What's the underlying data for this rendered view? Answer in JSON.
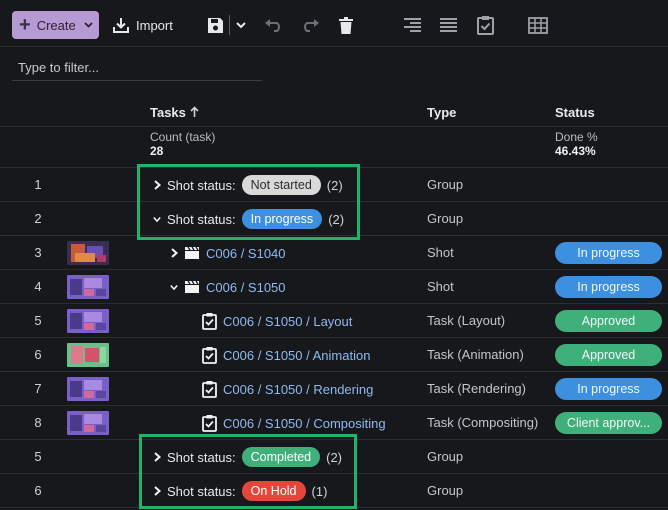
{
  "toolbar": {
    "create_label": "Create",
    "import_label": "Import",
    "icons": [
      "plus-icon",
      "chevron-down-icon",
      "import-icon",
      "save-icon",
      "undo-icon",
      "redo-icon",
      "trash-icon",
      "align-right-icon",
      "align-justify-icon",
      "clipboard-check-icon",
      "table-icon"
    ]
  },
  "filter": {
    "placeholder": "Type to filter..."
  },
  "columns": {
    "tasks": "Tasks",
    "type": "Type",
    "status": "Status"
  },
  "summary": {
    "count_label": "Count (task)",
    "count_value": "28",
    "done_label": "Done %",
    "done_value": "46.43%"
  },
  "colors": {
    "accent": "#b69bd3",
    "in_progress": "#3d8fe0",
    "approved": "#3fb07a",
    "not_started": "#d9d9d9",
    "on_hold": "#e5463c",
    "highlight": "#1eb46b",
    "link": "#8fbaf0"
  },
  "rows": [
    {
      "num": "1",
      "prefix": "Shot status:",
      "badge": "Not started",
      "count": "(2)",
      "type": "Group"
    },
    {
      "num": "2",
      "prefix": "Shot status:",
      "badge": "In progress",
      "count": "(2)",
      "type": "Group"
    },
    {
      "num": "3",
      "name": "C006 / S1040",
      "type": "Shot",
      "status": "In progress"
    },
    {
      "num": "4",
      "name": "C006 / S1050",
      "type": "Shot",
      "status": "In progress"
    },
    {
      "num": "5",
      "name": "C006 / S1050 / Layout",
      "type": "Task (Layout)",
      "status": "Approved"
    },
    {
      "num": "6",
      "name": "C006 / S1050 / Animation",
      "type": "Task (Animation)",
      "status": "Approved"
    },
    {
      "num": "7",
      "name": "C006 / S1050 / Rendering",
      "type": "Task (Rendering)",
      "status": "In progress"
    },
    {
      "num": "8",
      "name": "C006 / S1050 / Compositing",
      "type": "Task (Compositing)",
      "status": "Client approv..."
    },
    {
      "num": "5",
      "prefix": "Shot status:",
      "badge": "Completed",
      "count": "(2)",
      "type": "Group"
    },
    {
      "num": "6",
      "prefix": "Shot status:",
      "badge": "On Hold",
      "count": "(1)",
      "type": "Group"
    }
  ]
}
